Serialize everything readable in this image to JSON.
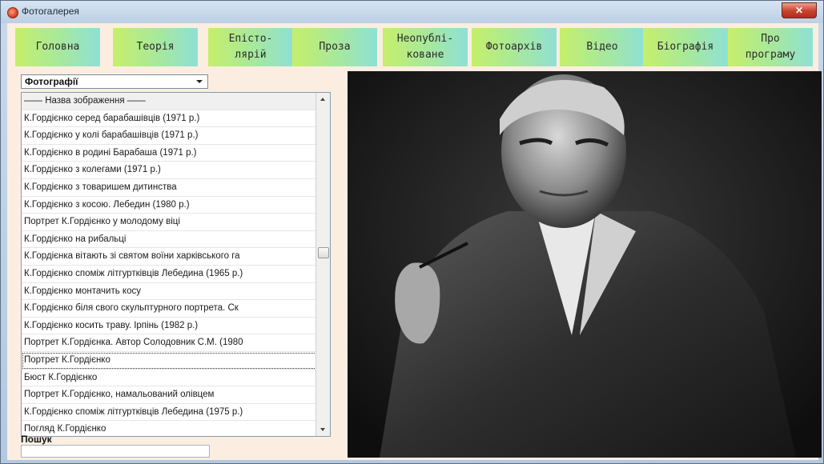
{
  "window": {
    "title": "Фотогалерея",
    "close_glyph": "✕"
  },
  "nav": [
    {
      "label": "Головна"
    },
    {
      "label": "Теорія"
    },
    {
      "label": "Епісто-\nлярій"
    },
    {
      "label": "Проза"
    },
    {
      "label": "Неопублі-\nковане"
    },
    {
      "label": "Фотоархів"
    },
    {
      "label": "Відео"
    },
    {
      "label": "Біографія"
    },
    {
      "label": "Про\nпрограму"
    }
  ],
  "category_select": {
    "value": "Фотографії"
  },
  "list": {
    "header": "—— Назва зображення ——",
    "items": [
      "К.Гордієнко серед барабашівців (1971 р.)",
      "К.Гордієнко у колі барабашівців (1971 р.)",
      "К.Гордієнко в родині Барабаша (1971 р.)",
      "К.Гордієнко з колегами (1971 р.)",
      "К.Гордієнко з товаришем дитинства",
      "К.Гордієнко з косою. Лебедин (1980 р.)",
      "Портрет К.Гордієнко у молодому віці",
      "К.Гордієнко на рибальці",
      "К.Гордієнка вітають зі святом воїни харківського га",
      "К.Гордієнко споміж літгуртківців Лебедина (1965 р.)",
      "К.Гордієнко монтачить косу",
      "К.Гордієнко біля свого скульптурного портрета. Ск",
      "К.Гордієнко косить траву. Ірпінь (1982 р.)",
      "Портрет К.Гордієнка. Автор Солодовник С.М. (1980",
      "Портрет К.Гордієнко",
      "Бюст К.Гордієнко",
      "Портрет К.Гордієнко, намальований олівцем",
      "К.Гордієнко споміж літгуртківців Лебедина (1975 р.)",
      "Погляд К.Гордієнко"
    ],
    "selected_index": 14
  },
  "search": {
    "label": "Пошук",
    "value": ""
  }
}
